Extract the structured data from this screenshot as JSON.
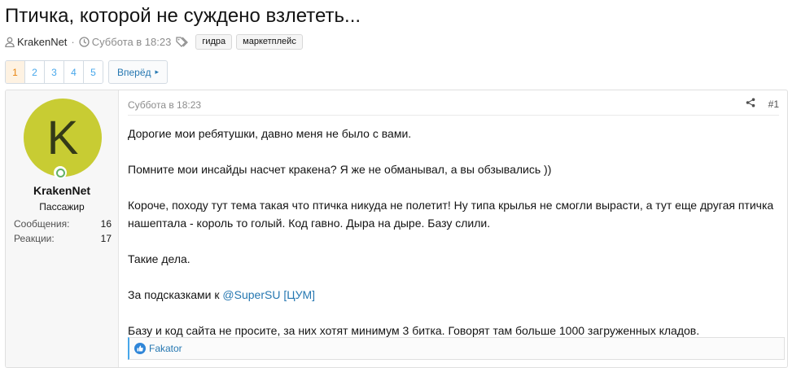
{
  "thread": {
    "title": "Птичка, которой не суждено взлететь...",
    "author": "KrakenNet",
    "separator": "·",
    "date": "Суббота в 18:23",
    "tags": [
      "гидра",
      "маркетплейс"
    ]
  },
  "pagination": {
    "pages": [
      "1",
      "2",
      "3",
      "4",
      "5"
    ],
    "current": "1",
    "next_label": "Вперёд",
    "next_arrow": "▸"
  },
  "post": {
    "user": {
      "avatar_letter": "K",
      "avatar_color": "#c8cc33",
      "name": "KrakenNet",
      "title": "Пассажир",
      "stats": [
        {
          "label": "Сообщения:",
          "value": "16"
        },
        {
          "label": "Реакции:",
          "value": "17"
        }
      ]
    },
    "date": "Суббота в 18:23",
    "number": "#1",
    "paragraphs": [
      "Дорогие мои ребятушки, давно меня не было с вами.",
      "Помните мои инсайды насчет кракена? Я же не обманывал, а вы обзывались ))",
      "Короче, походу тут тема такая что птичка никуда не полетит! Ну типа крылья не смогли вырасти, а тут еще другая птичка нашептала - король то голый. Код гавно. Дыра на дыре. Базу слили.",
      "Такие дела."
    ],
    "hints_prefix": "За подсказками к ",
    "hints_link": "@SuperSU [ЦУМ]",
    "last_paragraph": "Базу и код сайта не просите, за них хотят минимум 3 битка. Говорят там больше 1000 загруженных кладов.",
    "reactions_user": "Fakator"
  },
  "colors": {
    "link": "#2577b1",
    "page_active_bg": "#fef2e2",
    "page_active_text": "#e8840e",
    "online": "#63b265",
    "like": "#2f86d8"
  }
}
